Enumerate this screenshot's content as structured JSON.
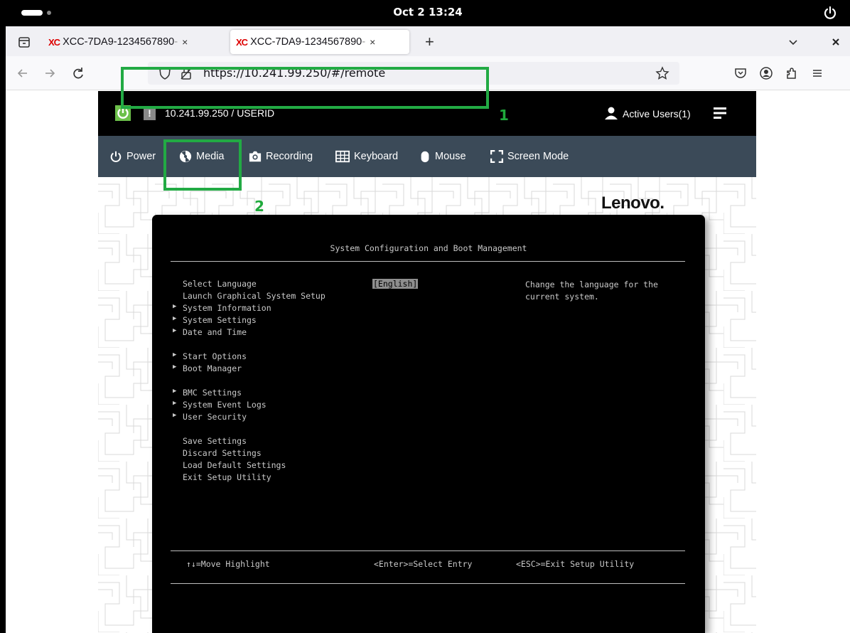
{
  "system_bar": {
    "clock": "Oct 2  13:24"
  },
  "browser": {
    "tabs": [
      {
        "favicon": "XC",
        "title": "XCC-7DA9-1234567890",
        "suffix": " - ",
        "close": "×"
      },
      {
        "favicon": "XC",
        "title": "XCC-7DA9-1234567890",
        "suffix": " - ",
        "close": "×"
      }
    ],
    "new_tab": "+",
    "url": "https://10.241.99.250/#/remote"
  },
  "xcc": {
    "header": {
      "address_user": "10.241.99.250 / USERID",
      "alert_badge": "!",
      "active_users": "Active Users(1)"
    },
    "toolbar": [
      {
        "label": "Power"
      },
      {
        "label": "Media"
      },
      {
        "label": "Recording"
      },
      {
        "label": "Keyboard"
      },
      {
        "label": "Mouse"
      },
      {
        "label": "Screen Mode"
      }
    ],
    "brand": "Lenovo."
  },
  "bios": {
    "title": "System Configuration and Boot Management",
    "items": [
      {
        "label": "Select Language",
        "submenu": false
      },
      {
        "label": "Launch Graphical System Setup",
        "submenu": false
      },
      {
        "label": "System Information",
        "submenu": true
      },
      {
        "label": "System Settings",
        "submenu": true
      },
      {
        "label": "Date and Time",
        "submenu": true
      },
      {
        "label": "Start Options",
        "submenu": true
      },
      {
        "label": "Boot Manager",
        "submenu": true
      },
      {
        "label": "BMC Settings",
        "submenu": true
      },
      {
        "label": "System Event Logs",
        "submenu": true
      },
      {
        "label": "User Security",
        "submenu": true
      },
      {
        "label": "Save Settings",
        "submenu": false
      },
      {
        "label": "Discard Settings",
        "submenu": false
      },
      {
        "label": "Load Default Settings",
        "submenu": false
      },
      {
        "label": "Exit Setup Utility",
        "submenu": false
      }
    ],
    "selected_value": "[English]",
    "help_text": "Change the language for the\ncurrent system.",
    "footer": {
      "move": "↑↓=Move Highlight",
      "select": "<Enter>=Select Entry",
      "exit": "<ESC>=Exit Setup Utility"
    }
  },
  "annotations": [
    "1",
    "2"
  ]
}
